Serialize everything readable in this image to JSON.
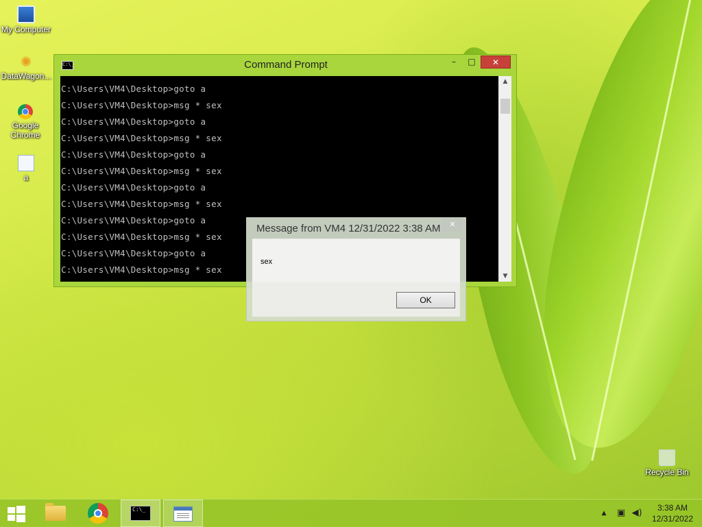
{
  "desktop": {
    "icons": [
      {
        "label": "My Computer",
        "icon": "computer-icon"
      },
      {
        "label": "DataWagon...",
        "icon": "datawagon-icon"
      },
      {
        "label": "Google Chrome",
        "icon": "chrome-icon"
      },
      {
        "label": "a",
        "icon": "file-icon"
      },
      {
        "label": "Recycle Bin",
        "icon": "recycle-bin-icon"
      }
    ]
  },
  "cmd_window": {
    "title": "Command Prompt",
    "icon_text": "C:\\_",
    "minimize": "–",
    "maximize": "□",
    "close": "✕",
    "lines": [
      "C:\\Users\\VM4\\Desktop>goto a",
      "C:\\Users\\VM4\\Desktop>msg * sex",
      "C:\\Users\\VM4\\Desktop>goto a",
      "C:\\Users\\VM4\\Desktop>msg * sex",
      "C:\\Users\\VM4\\Desktop>goto a",
      "C:\\Users\\VM4\\Desktop>msg * sex",
      "C:\\Users\\VM4\\Desktop>goto a",
      "C:\\Users\\VM4\\Desktop>msg * sex",
      "C:\\Users\\VM4\\Desktop>goto a",
      "C:\\Users\\VM4\\Desktop>msg * sex",
      "C:\\Users\\VM4\\Desktop>goto a",
      "C:\\Users\\VM4\\Desktop>msg * sex"
    ],
    "scroll_up": "▲",
    "scroll_down": "▼"
  },
  "message_dialog": {
    "title": "Message from VM4 12/31/2022 3:38 AM",
    "close": "✕",
    "text": "sex",
    "ok_label": "OK"
  },
  "taskbar": {
    "cmd_icon_text": "C:\\_",
    "tray_up": "▲",
    "network_glyph": "▣",
    "volume_glyph": "◀)",
    "clock_time": "3:38 AM",
    "clock_date": "12/31/2022"
  }
}
